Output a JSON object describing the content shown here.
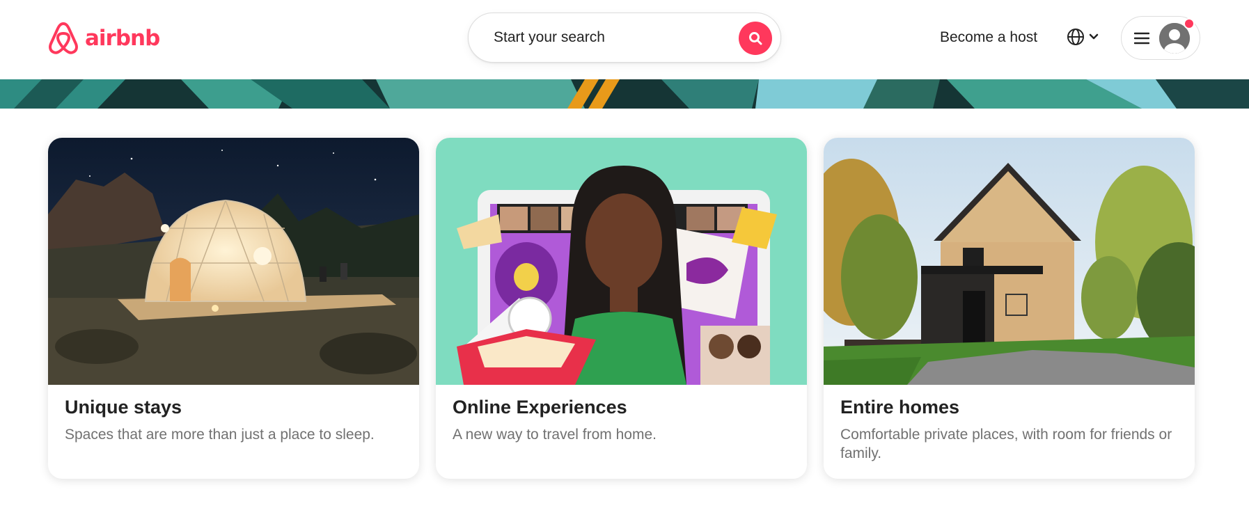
{
  "brand": {
    "name": "airbnb",
    "color": "#FF385C"
  },
  "header": {
    "search_placeholder": "Start your search",
    "become_host": "Become a host",
    "icons": [
      "airbnb-logo-icon",
      "search-icon",
      "globe-icon",
      "chevron-down-icon",
      "menu-icon",
      "user-avatar-icon"
    ]
  },
  "cards": [
    {
      "title": "Unique stays",
      "subtitle": "Spaces that are more than just a place to sleep."
    },
    {
      "title": "Online Experiences",
      "subtitle": "A new way to travel from home."
    },
    {
      "title": "Entire homes",
      "subtitle": "Comfortable private places, with room for friends or family."
    }
  ]
}
